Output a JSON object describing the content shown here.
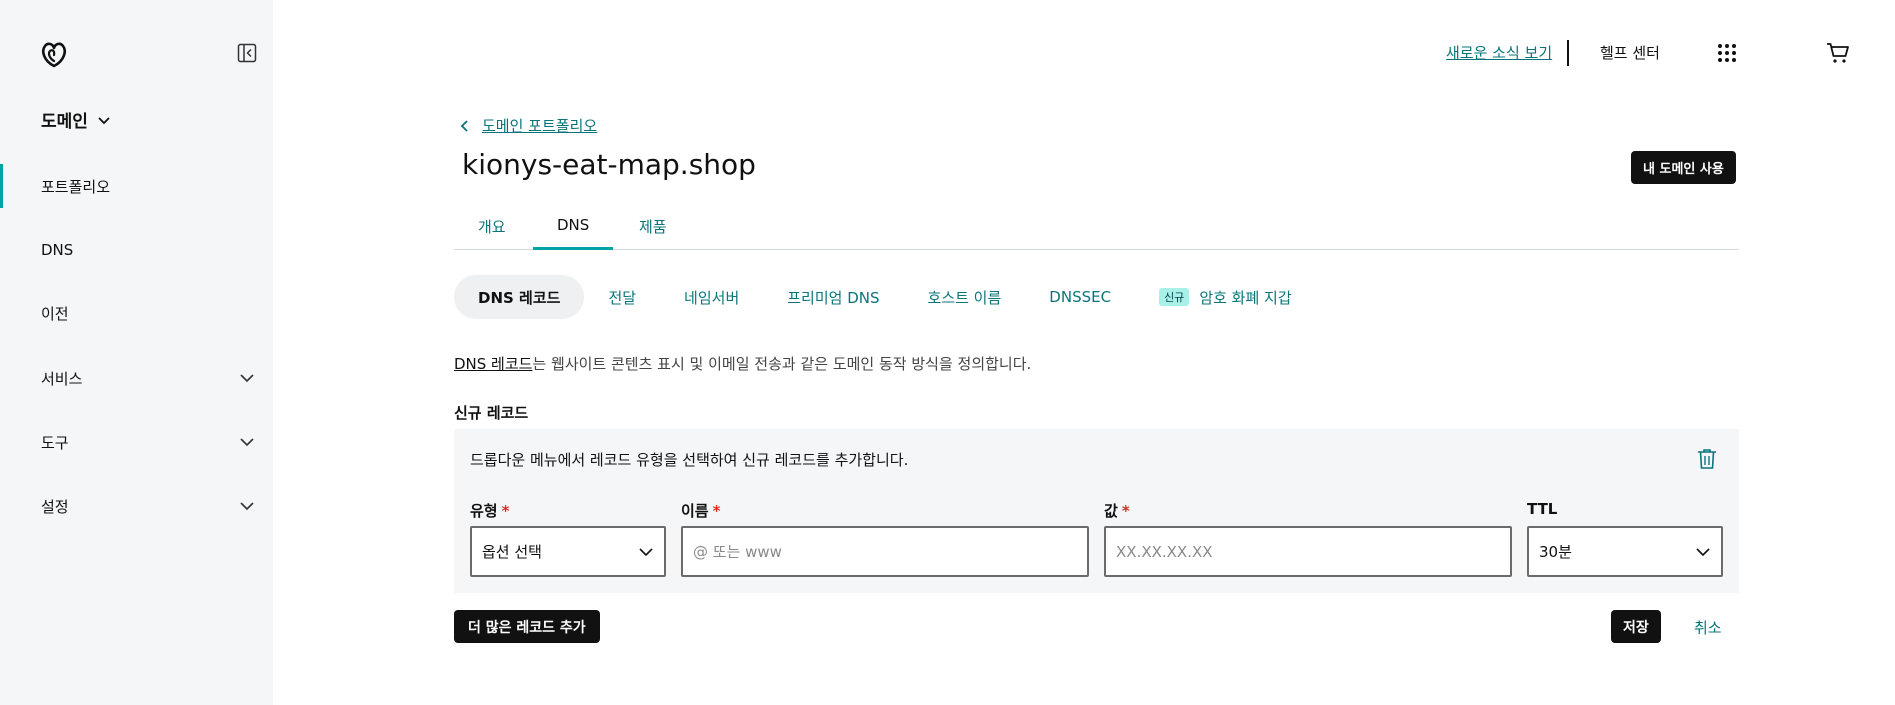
{
  "sidebar": {
    "product": "도메인",
    "items": [
      {
        "label": "포트폴리오"
      },
      {
        "label": "DNS"
      },
      {
        "label": "이전"
      },
      {
        "label": "서비스"
      },
      {
        "label": "도구"
      },
      {
        "label": "설정"
      }
    ]
  },
  "header": {
    "news_link": "새로운 소식 보기",
    "help": "헬프 센터"
  },
  "main": {
    "back_link": "도메인 포트폴리오",
    "domain_title": "kionys-eat-map.shop",
    "use_domain_button": "내 도메인 사용",
    "tabs": [
      {
        "label": "개요"
      },
      {
        "label": "DNS"
      },
      {
        "label": "제품"
      }
    ],
    "subtabs": [
      {
        "label": "DNS 레코드"
      },
      {
        "label": "전달"
      },
      {
        "label": "네임서버"
      },
      {
        "label": "프리미엄 DNS"
      },
      {
        "label": "호스트 이름"
      },
      {
        "label": "DNSSEC"
      },
      {
        "label": "암호 화폐 지갑",
        "badge": "신규"
      }
    ],
    "description_link": "DNS 레코드",
    "description_rest": "는 웹사이트 콘텐츠 표시 및 이메일 전송과 같은 도메인 동작 방식을 정의합니다.",
    "new_record_label": "신규 레코드",
    "panel_description": "드롭다운 메뉴에서 레코드 유형을 선택하여 신규 레코드를 추가합니다.",
    "fields": {
      "type": {
        "label": "유형",
        "value": "옵션 선택"
      },
      "name": {
        "label": "이름",
        "placeholder": "@ 또는 www",
        "value": ""
      },
      "value": {
        "label": "값",
        "placeholder": "XX.XX.XX.XX",
        "value": ""
      },
      "ttl": {
        "label": "TTL",
        "value": "30분"
      }
    },
    "required_mark": "*",
    "add_more_button": "더 많은 레코드 추가",
    "save_button": "저장",
    "cancel_button": "취소"
  },
  "colors": {
    "accent": "#00a4a6",
    "link": "#09757a",
    "sidebar_bg": "#f5f6f7",
    "primary_button": "#111111",
    "required": "#d93025"
  },
  "icons": {
    "logo": "godaddy-logo-icon",
    "collapse": "sidebar-collapse-icon",
    "apps": "apps-grid-icon",
    "cart": "shopping-cart-icon",
    "back": "chevron-left-icon",
    "trash": "trash-icon",
    "dropdown": "chevron-down-icon"
  }
}
